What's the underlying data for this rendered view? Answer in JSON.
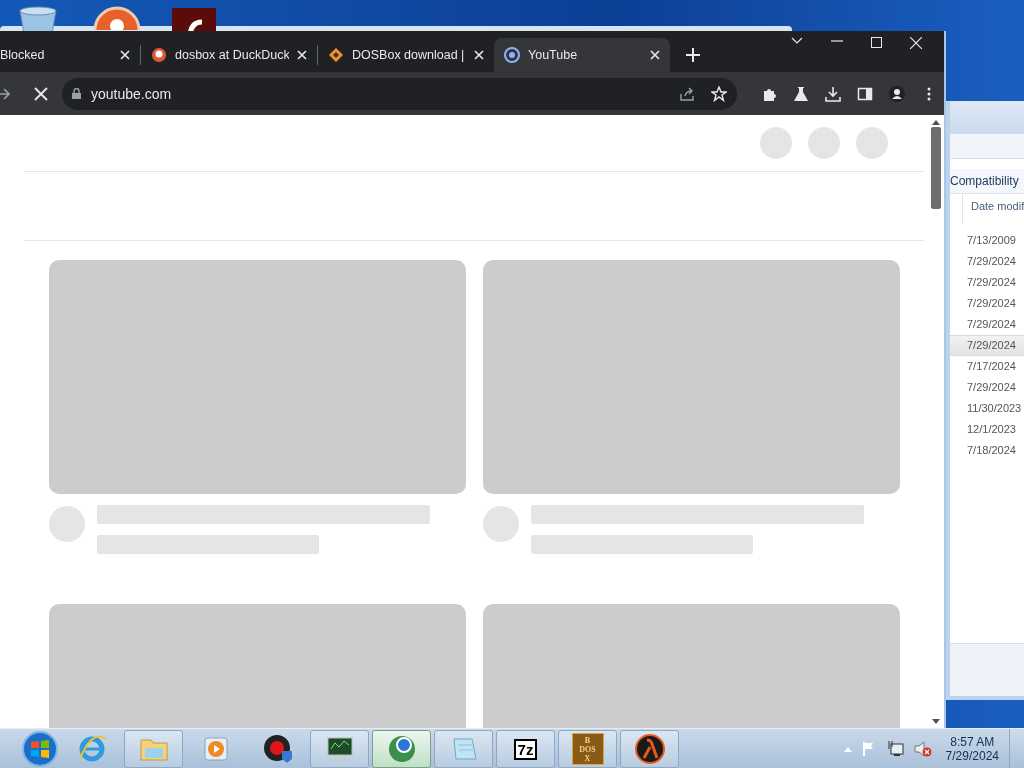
{
  "browser": {
    "tabs": [
      {
        "kind": "none",
        "title": "Blocked",
        "selected": false
      },
      {
        "kind": "duck",
        "title": "dosbox at DuckDuck",
        "selected": false
      },
      {
        "kind": "diamond",
        "title": "DOSBox download |",
        "selected": false
      },
      {
        "kind": "tube",
        "title": "YouTube",
        "selected": true
      }
    ],
    "address": "youtube.com",
    "loading": true
  },
  "explorer": {
    "column_header": "Compatibility",
    "date_column": "Date modif",
    "rows": [
      {
        "date": "7/13/2009",
        "selected": false
      },
      {
        "date": "7/29/2024",
        "selected": false
      },
      {
        "date": "7/29/2024",
        "selected": false
      },
      {
        "date": "7/29/2024",
        "selected": false
      },
      {
        "date": "7/29/2024",
        "selected": false
      },
      {
        "date": "7/29/2024",
        "selected": true
      },
      {
        "date": "7/17/2024",
        "selected": false
      },
      {
        "date": "7/29/2024",
        "selected": false
      },
      {
        "date": "11/30/2023",
        "selected": false
      },
      {
        "date": "12/1/2023",
        "selected": false
      },
      {
        "date": "7/18/2024",
        "selected": false
      }
    ]
  },
  "taskbar": {
    "apps": [
      {
        "kind": "ie",
        "running": false,
        "selected": false
      },
      {
        "kind": "folder",
        "running": true,
        "selected": false
      },
      {
        "kind": "media",
        "running": false,
        "selected": false
      },
      {
        "kind": "shield",
        "running": false,
        "selected": false
      },
      {
        "kind": "monitor",
        "running": true,
        "selected": false
      },
      {
        "kind": "globe",
        "running": true,
        "selected": true
      },
      {
        "kind": "notepad",
        "running": true,
        "selected": false
      },
      {
        "kind": "sevenzip",
        "label": "7z",
        "running": true,
        "selected": false
      },
      {
        "kind": "dosbox",
        "letters": [
          "B",
          "DOS",
          "X"
        ],
        "running": true,
        "selected": false
      },
      {
        "kind": "lambda",
        "running": true,
        "selected": false
      }
    ],
    "clock_time": "8:57 AM",
    "clock_date": "7/29/2024"
  }
}
